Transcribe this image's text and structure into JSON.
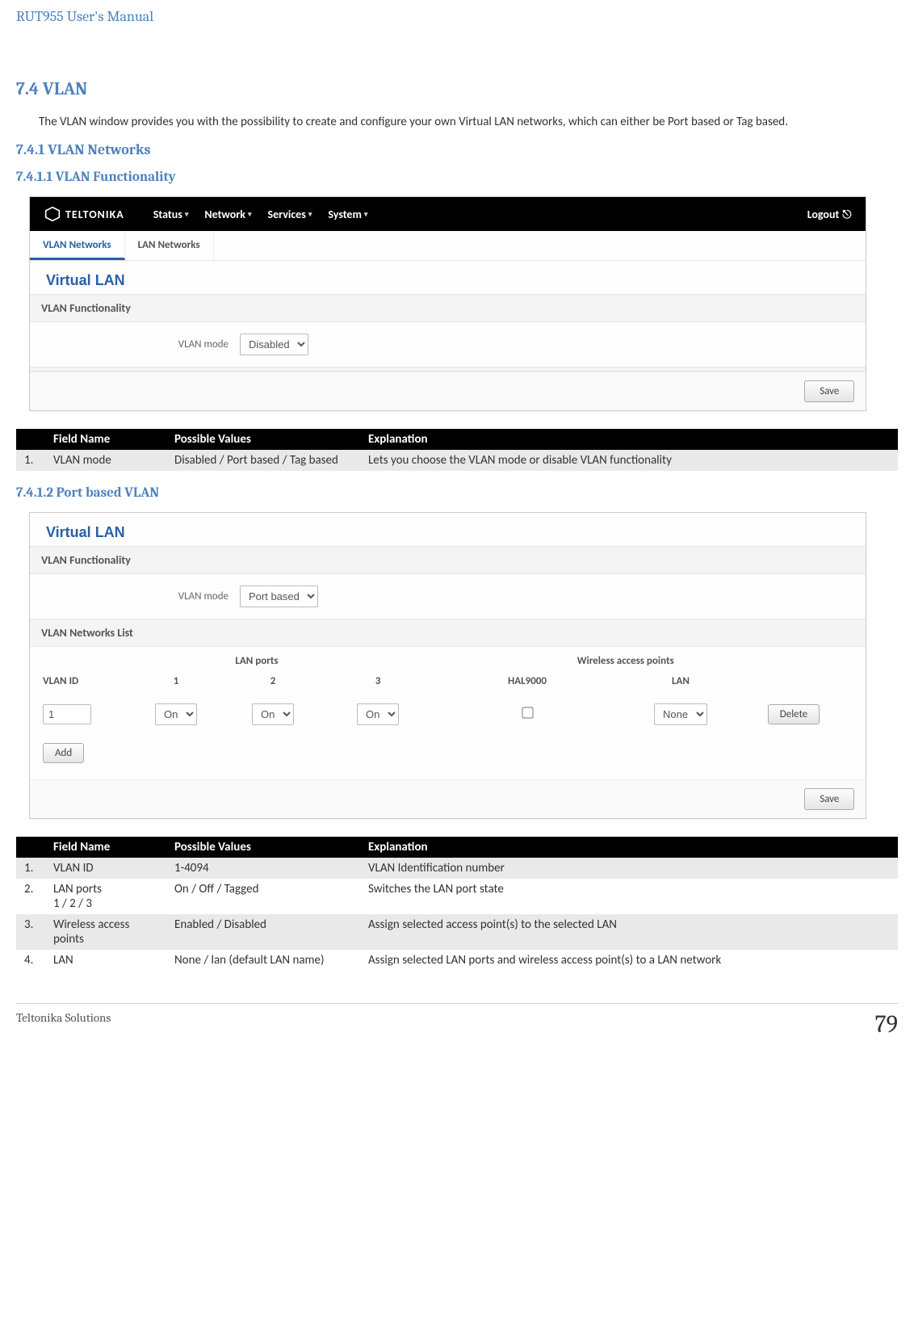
{
  "doc_header": "RUT955 User's Manual",
  "sec": {
    "h2": "7.4   VLAN",
    "intro": "The VLAN window provides you with the possibility to create and configure your own Virtual LAN networks, which can either be Port based or Tag based.",
    "h3": "7.4.1 VLAN Networks",
    "h4a": "7.4.1.1   VLAN Functionality",
    "h4b": "7.4.1.2   Port based VLAN"
  },
  "shot1": {
    "brand": "TELTONIKA",
    "menu": [
      "Status",
      "Network",
      "Services",
      "System"
    ],
    "logout": "Logout",
    "tabs": [
      "VLAN Networks",
      "LAN Networks"
    ],
    "panel_title": "Virtual LAN",
    "section": "VLAN Functionality",
    "label_vlan_mode": "VLAN mode",
    "vlan_mode_value": "Disabled",
    "save": "Save"
  },
  "table1": {
    "headers": [
      "",
      "Field Name",
      "Possible Values",
      "Explanation"
    ],
    "rows": [
      {
        "n": "1.",
        "field": "VLAN mode",
        "vals": "Disabled / Port based / Tag based",
        "exp": "Lets you choose the VLAN mode or disable VLAN functionality"
      }
    ]
  },
  "shot2": {
    "panel_title": "Virtual LAN",
    "section_func": "VLAN Functionality",
    "label_vlan_mode": "VLAN mode",
    "vlan_mode_value": "Port based",
    "section_list": "VLAN Networks List",
    "top_hdr": {
      "blank": "",
      "lan_ports": "LAN ports",
      "wap": "Wireless access points"
    },
    "col_hdr": {
      "vlan_id": "VLAN ID",
      "p1": "1",
      "p2": "2",
      "p3": "3",
      "wap": "HAL9000",
      "lan": "LAN",
      "blank": ""
    },
    "row": {
      "vlan_id": "1",
      "p1": "On",
      "p2": "On",
      "p3": "On",
      "lan": "None",
      "del": "Delete"
    },
    "add": "Add",
    "save": "Save"
  },
  "table2": {
    "headers": [
      "",
      "Field Name",
      "Possible Values",
      "Explanation"
    ],
    "rows": [
      {
        "n": "1.",
        "field": "VLAN ID",
        "vals": "1-4094",
        "exp": "VLAN Identification number"
      },
      {
        "n": "2.",
        "field": "LAN ports\n 1 / 2 / 3",
        "vals": "On / Off / Tagged",
        "exp": "Switches the LAN port state"
      },
      {
        "n": "3.",
        "field": "Wireless access points",
        "vals": "Enabled / Disabled",
        "exp": "Assign selected access point(s) to the selected LAN"
      },
      {
        "n": "4.",
        "field": "LAN",
        "vals": "None / lan (default LAN name)",
        "exp": "Assign selected LAN ports and wireless access point(s) to a LAN network"
      }
    ]
  },
  "footer": {
    "company": "Teltonika Solutions",
    "page": "79"
  }
}
